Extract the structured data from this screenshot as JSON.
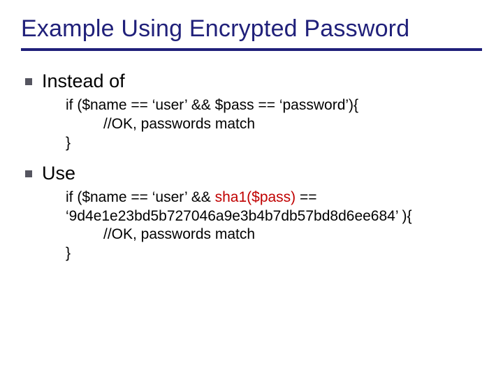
{
  "title": "Example Using Encrypted Password",
  "bullets": {
    "instead": "Instead of",
    "use": "Use"
  },
  "code1": {
    "l1": "if ($name == ‘user’ && $pass == ‘password’){",
    "l2": "//OK, passwords match",
    "l3": "}"
  },
  "code2": {
    "l1a": "if ($name == ‘user’ && ",
    "sha": "sha1($pass)",
    "l1b": " ==",
    "l2": "‘9d4e1e23bd5b727046a9e3b4b7db57bd8d6ee684’ ){",
    "l3": "//OK, passwords match",
    "l4": "}"
  }
}
